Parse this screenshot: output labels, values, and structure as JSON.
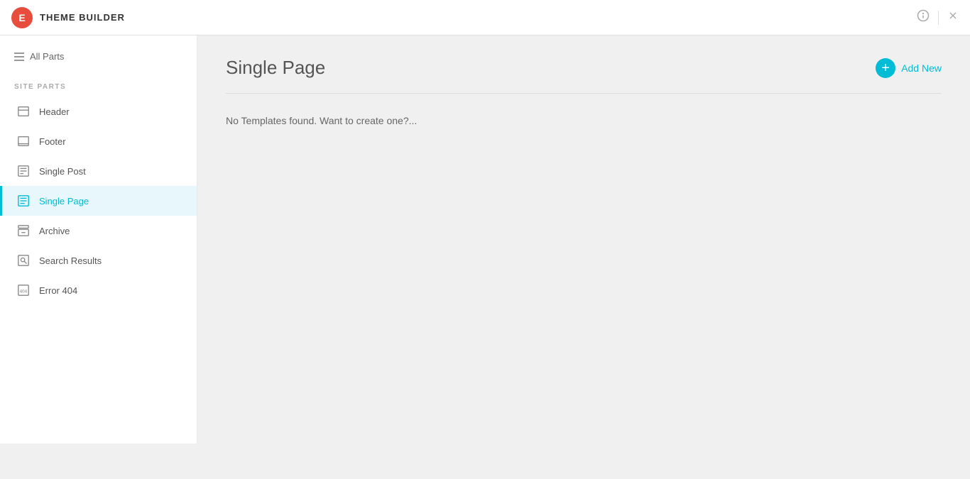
{
  "topbar": {
    "logo_letter": "E",
    "title": "THEME BUILDER",
    "info_icon": "ℹ",
    "close_icon": "✕"
  },
  "sidebar": {
    "all_parts_label": "All Parts",
    "section_label": "SITE PARTS",
    "items": [
      {
        "id": "header",
        "label": "Header",
        "icon": "header"
      },
      {
        "id": "footer",
        "label": "Footer",
        "icon": "footer"
      },
      {
        "id": "single-post",
        "label": "Single Post",
        "icon": "post"
      },
      {
        "id": "single-page",
        "label": "Single Page",
        "icon": "page",
        "active": true
      },
      {
        "id": "archive",
        "label": "Archive",
        "icon": "archive"
      },
      {
        "id": "search-results",
        "label": "Search Results",
        "icon": "search"
      },
      {
        "id": "error-404",
        "label": "Error 404",
        "icon": "error"
      }
    ]
  },
  "main": {
    "title": "Single Page",
    "add_new_label": "Add New",
    "empty_message": "No Templates found. Want to create one?..."
  }
}
